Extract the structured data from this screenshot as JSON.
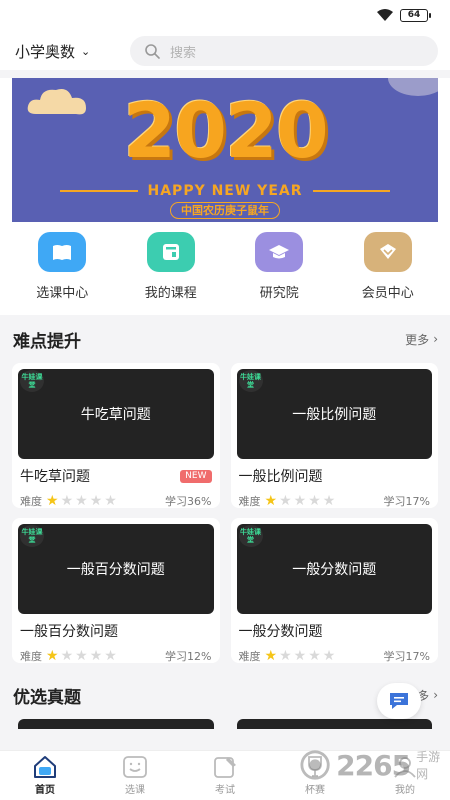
{
  "status": {
    "battery": "64"
  },
  "header": {
    "grade": "小学奥数",
    "search_placeholder": "搜索"
  },
  "banner": {
    "year": "2020",
    "greeting": "HAPPY NEW YEAR",
    "subtitle": "中国农历庚子鼠年"
  },
  "quick_nav": [
    {
      "label": "选课中心",
      "icon": "book-icon",
      "color": "#3fa8f5"
    },
    {
      "label": "我的课程",
      "icon": "course-card-icon",
      "color": "#3ccdb0"
    },
    {
      "label": "研究院",
      "icon": "graduation-cap-icon",
      "color": "#9b8fe0"
    },
    {
      "label": "会员中心",
      "icon": "vip-diamond-icon",
      "color": "#d7b27a"
    }
  ],
  "section_difficult": {
    "title": "难点提升",
    "more": "更多",
    "courses": [
      {
        "thumb_title": "牛吃草问题",
        "title": "牛吃草问题",
        "badge": "NEW",
        "difficulty_label": "难度",
        "rating": 1,
        "progress": "学习36%"
      },
      {
        "thumb_title": "一般比例问题",
        "title": "一般比例问题",
        "badge": "",
        "difficulty_label": "难度",
        "rating": 1,
        "progress": "学习17%"
      },
      {
        "thumb_title": "一般百分数问题",
        "title": "一般百分数问题",
        "badge": "",
        "difficulty_label": "难度",
        "rating": 1,
        "progress": "学习12%"
      },
      {
        "thumb_title": "一般分数问题",
        "title": "一般分数问题",
        "badge": "",
        "difficulty_label": "难度",
        "rating": 1,
        "progress": "学习17%"
      }
    ]
  },
  "thumb_brand": "牛娃课堂",
  "section_selected": {
    "title": "优选真题",
    "more": "更多"
  },
  "tabs": [
    {
      "label": "首页",
      "icon": "home-icon",
      "active": true
    },
    {
      "label": "选课",
      "icon": "select-course-icon",
      "active": false
    },
    {
      "label": "考试",
      "icon": "exam-icon",
      "active": false
    },
    {
      "label": "杯赛",
      "icon": "trophy-icon",
      "active": false
    },
    {
      "label": "我的",
      "icon": "profile-icon",
      "active": false
    }
  ],
  "watermark": {
    "number": "2265",
    "text": "手游网"
  }
}
